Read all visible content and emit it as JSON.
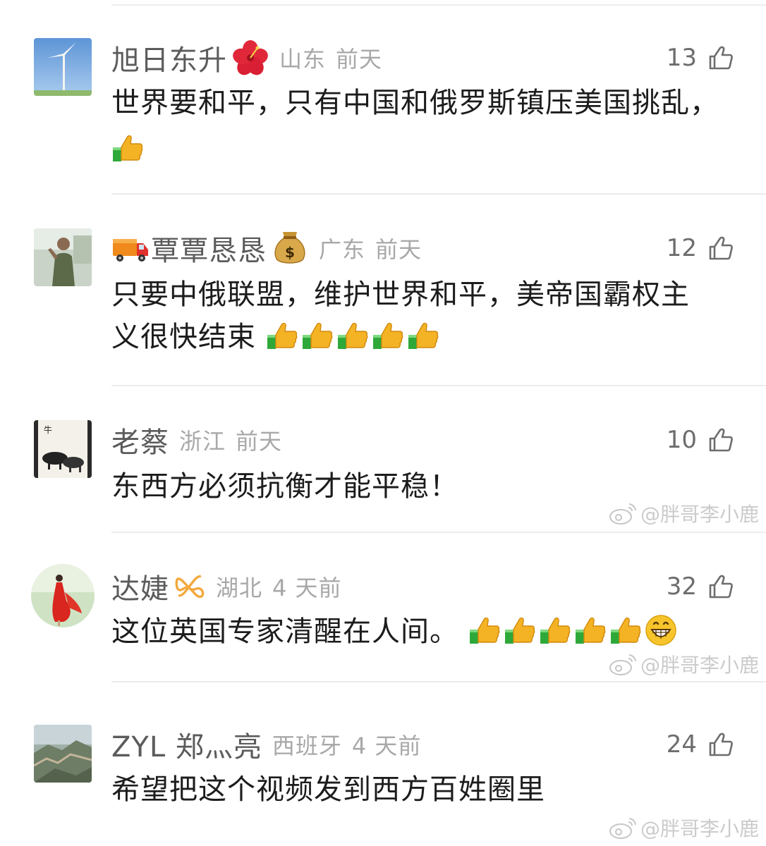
{
  "comments": [
    {
      "username": "旭日东升",
      "badge": "hibiscus-icon",
      "region": "山东",
      "time": "前天",
      "likes": "13",
      "text": "世界要和平，只有中国和俄罗斯镇压美国挑乱，",
      "thumbs": 1
    },
    {
      "prefix_icon": "truck-icon",
      "username": "覃覃恳恳",
      "badge": "money-bag-icon",
      "region": "广东",
      "time": "前天",
      "likes": "12",
      "text": "只要中俄联盟，维护世界和平，美帝国霸权主义很快结束",
      "thumbs": 5
    },
    {
      "username": "老蔡",
      "region": "浙江",
      "time": "前天",
      "likes": "10",
      "text": "东西方必须抗衡才能平稳！",
      "thumbs": 0
    },
    {
      "username": "达婕",
      "badge": "infinity-icon",
      "region": "湖北",
      "time": "4 天前",
      "likes": "32",
      "text": "这位英国专家清醒在人间。",
      "thumbs": 5,
      "grin": true
    },
    {
      "username": "ZYL 郑灬亮",
      "region": "西班牙",
      "time": "4 天前",
      "likes": "24",
      "text": "希望把这个视频发到西方百姓圈里",
      "thumbs": 0
    }
  ],
  "watermark": "@胖哥李小鹿",
  "colors": {
    "username": "#5b5b5b",
    "meta": "#a8a8a8",
    "text": "#1c1c1c",
    "divider": "#ececec"
  }
}
